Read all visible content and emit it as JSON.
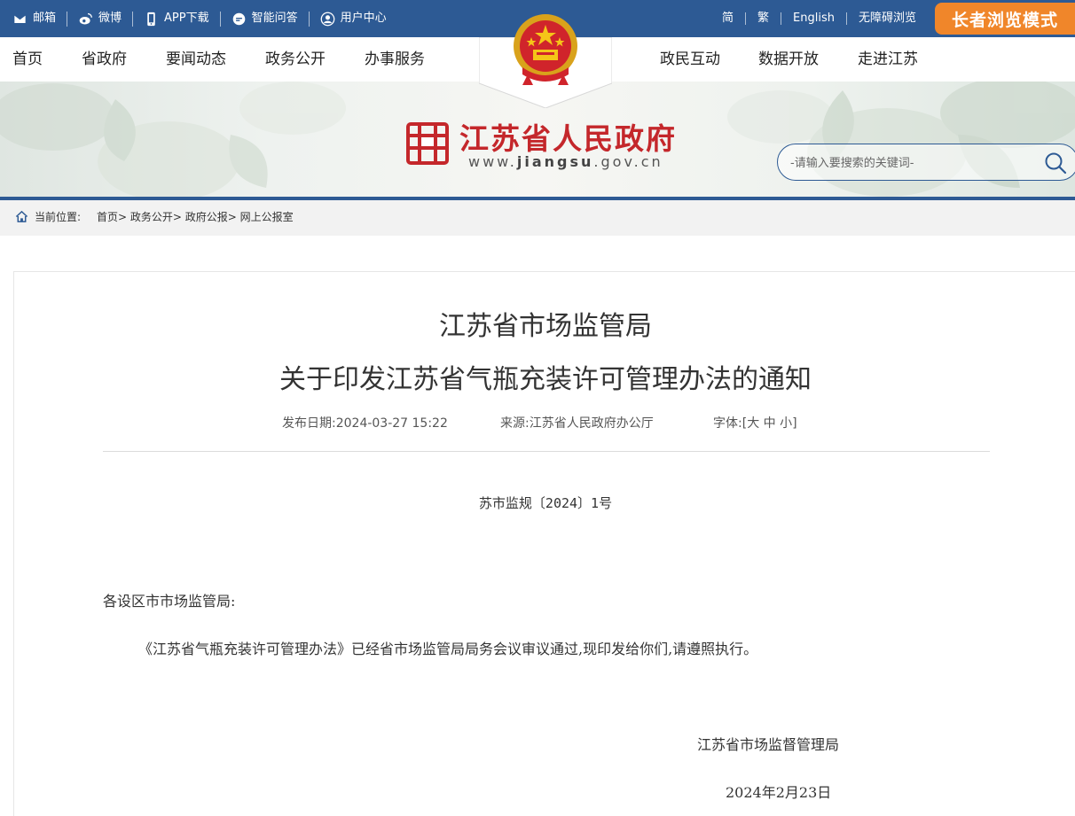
{
  "topbar": {
    "links": [
      {
        "label": "邮箱",
        "icon": "mail-icon"
      },
      {
        "label": "微博",
        "icon": "weibo-icon"
      },
      {
        "label": "APP下载",
        "icon": "phone-icon"
      },
      {
        "label": "智能问答",
        "icon": "chat-icon"
      },
      {
        "label": "用户中心",
        "icon": "user-icon"
      }
    ],
    "right_links": [
      "简",
      "繁",
      "English",
      "无障碍浏览"
    ],
    "elder_mode": "长者浏览模式"
  },
  "nav": {
    "left": [
      "首页",
      "省政府",
      "要闻动态",
      "政务公开",
      "办事服务"
    ],
    "right": [
      "政民互动",
      "数据开放",
      "走进江苏"
    ]
  },
  "banner": {
    "site_title": "江苏省人民政府",
    "domain_prefix": "www.",
    "domain_main": "jiangsu",
    "domain_suffix": ".gov.cn",
    "search_placeholder": "-请输入要搜索的关键词-"
  },
  "breadcrumb": {
    "label": "当前位置:",
    "items": [
      "首页>",
      "政务公开>",
      "政府公报>",
      "网上公报室"
    ]
  },
  "article": {
    "title_line1": "江苏省市场监管局",
    "title_line2": "关于印发江苏省气瓶充装许可管理办法的通知",
    "publish_date": "发布日期:2024-03-27 15:22",
    "source": "来源:江苏省人民政府办公厅",
    "font_label": "字体:[",
    "font_large": "大",
    "font_medium": "中",
    "font_small": "小",
    "font_close": "]",
    "doc_number": "苏市监规〔2024〕1号",
    "salutation": "各设区市市场监管局:",
    "paragraph1": "《江苏省气瓶充装许可管理办法》已经省市场监管局局务会议审议通过,现印发给你们,请遵照执行。",
    "signature": "江苏省市场监督管理局",
    "signature_date": "2024年2月23日"
  },
  "colors": {
    "topbar_bg": "#2d5a94",
    "elder_button": "#f0862a",
    "site_title_red": "#c4272b"
  }
}
